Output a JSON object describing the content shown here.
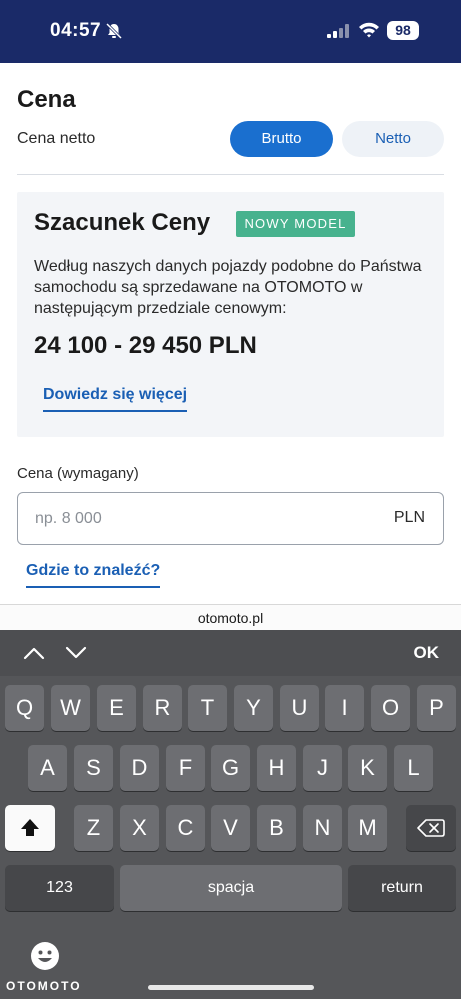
{
  "status_bar": {
    "time": "04:57",
    "battery": "98"
  },
  "price_section": {
    "title": "Cena",
    "net_label": "Cena netto",
    "toggle_brutto": "Brutto",
    "toggle_netto": "Netto",
    "toggle_selected": "Brutto"
  },
  "estimate": {
    "title": "Szacunek Ceny",
    "badge": "NOWY MODEL",
    "description": "Według naszych danych pojazdy podobne do Państwa samochodu są sprzedawane na OTOMOTO w następującym przedziale cenowym:",
    "range": "24 100 - 29 450 PLN",
    "learn_more": "Dowiedz się więcej"
  },
  "price_field": {
    "label": "Cena (wymagany)",
    "placeholder": "np. 8 000",
    "value": "",
    "unit": "PLN",
    "help_link": "Gdzie to znaleźć?"
  },
  "browser": {
    "url": "otomoto.pl"
  },
  "keyboard": {
    "accessory_done": "OK",
    "row1": [
      "Q",
      "W",
      "E",
      "R",
      "T",
      "Y",
      "U",
      "I",
      "O",
      "P"
    ],
    "row2": [
      "A",
      "S",
      "D",
      "F",
      "G",
      "H",
      "J",
      "K",
      "L"
    ],
    "row3": [
      "Z",
      "X",
      "C",
      "V",
      "B",
      "N",
      "M"
    ],
    "numbers_key": "123",
    "space_key": "spacja",
    "return_key": "return",
    "brand": "OTOMOTO"
  },
  "colors": {
    "status_bar_bg": "#1a2a68",
    "accent_blue": "#1a6fcf",
    "link_blue": "#1a5fb4",
    "badge_green": "#47b28e"
  },
  "icons": [
    "bell-slash-icon",
    "signal-icon",
    "wifi-icon",
    "battery-icon",
    "chevron-up-icon",
    "chevron-down-icon",
    "shift-icon",
    "backspace-icon",
    "emoji-icon"
  ]
}
